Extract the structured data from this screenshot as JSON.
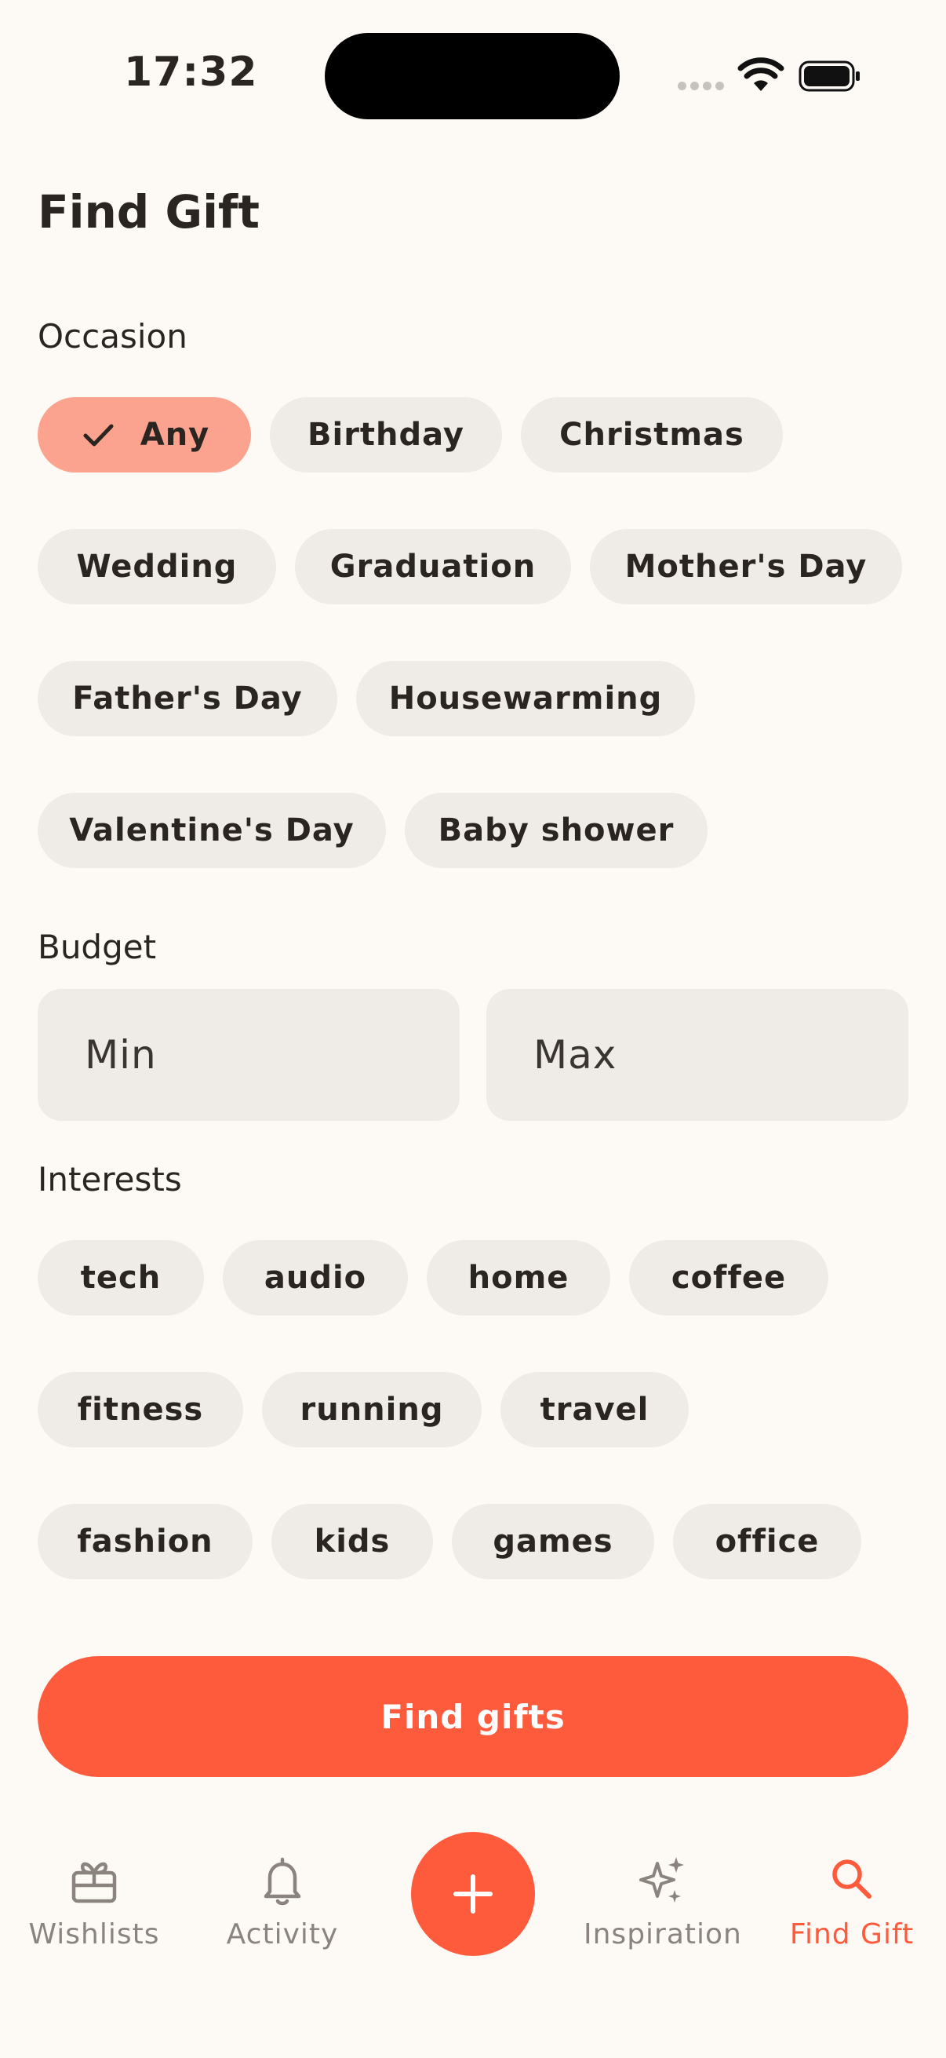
{
  "status_bar": {
    "time": "17:32"
  },
  "page": {
    "title": "Find Gift"
  },
  "occasion": {
    "label": "Occasion",
    "selected": "Any",
    "chips": [
      "Any",
      "Birthday",
      "Christmas",
      "Wedding",
      "Graduation",
      "Mother's Day",
      "Father's Day",
      "Housewarming",
      "Valentine's Day",
      "Baby shower"
    ]
  },
  "budget": {
    "label": "Budget",
    "min_placeholder": "Min",
    "max_placeholder": "Max"
  },
  "interests": {
    "label": "Interests",
    "chips": [
      "tech",
      "audio",
      "home",
      "coffee",
      "fitness",
      "running",
      "travel",
      "fashion",
      "kids",
      "games",
      "office"
    ]
  },
  "cta": {
    "label": "Find gifts"
  },
  "bottom_nav": {
    "items": [
      {
        "label": "Wishlists",
        "icon": "gift-icon"
      },
      {
        "label": "Activity",
        "icon": "bell-icon"
      },
      {
        "label": "Inspiration",
        "icon": "sparkles-icon"
      },
      {
        "label": "Find Gift",
        "icon": "search-icon",
        "active": true
      }
    ],
    "fab_icon": "plus-icon"
  },
  "colors": {
    "accent": "#fe5a3c",
    "selected_chip": "#fba38f",
    "chip_bg": "#efebe6",
    "background": "#fdfaf6"
  }
}
